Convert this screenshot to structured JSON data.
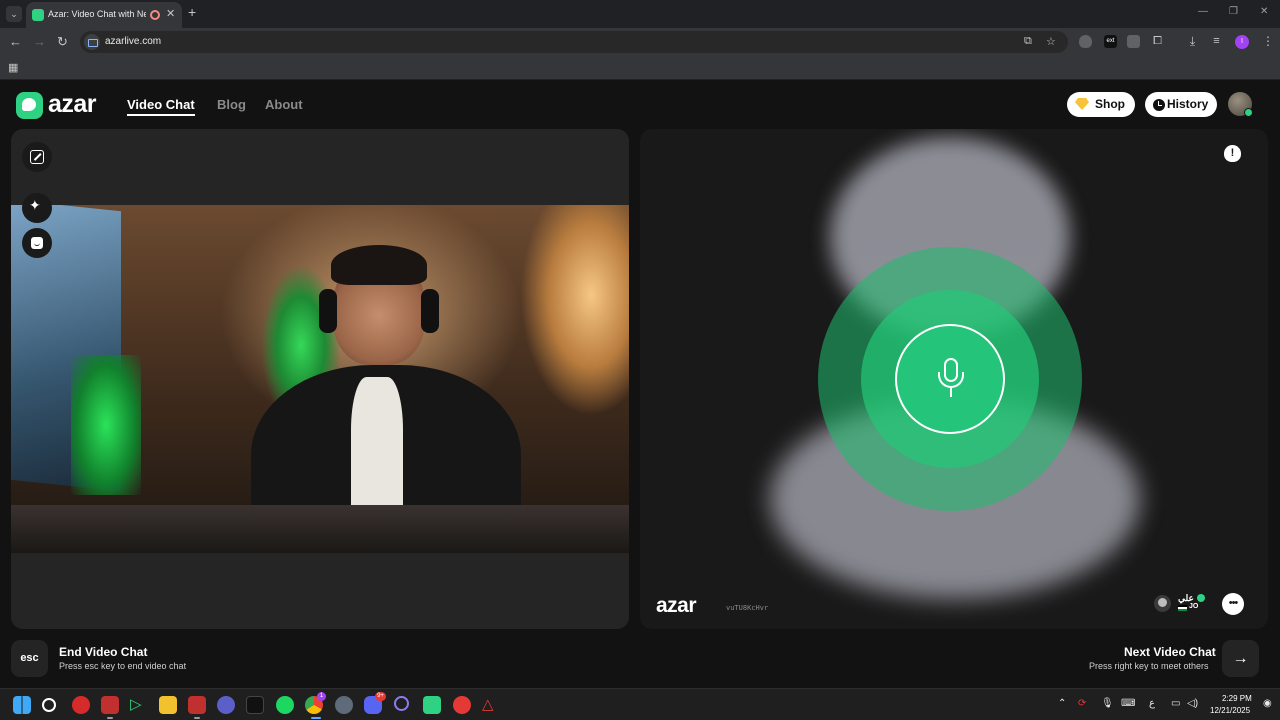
{
  "browser": {
    "tab_title": "Azar: Video Chat with New",
    "tab_close": "✕",
    "new_tab": "+",
    "url": "azarlive.com",
    "profile_initial": "I",
    "ext_label": "ext"
  },
  "header": {
    "logo_text": "azar",
    "nav": [
      "Video Chat",
      "Blog",
      "About"
    ],
    "shop_label": "Shop",
    "history_label": "History"
  },
  "remote": {
    "watermark": "azar",
    "peer_id": "vuTU8KcHvr",
    "peer_name": "علي",
    "peer_country": "JO"
  },
  "actions": {
    "end_key": "esc",
    "end_title": "End Video Chat",
    "end_sub": "Press esc key to end video chat",
    "next_title": "Next Video Chat",
    "next_sub": "Press right key to meet others",
    "next_key": "→"
  },
  "taskbar": {
    "time": "2:29 PM",
    "date": "12/21/2025",
    "lang": "ع",
    "chrome_badge": "1",
    "discord_badge": "9+"
  },
  "colors": {
    "accent": "#2ed282",
    "background": "#121212",
    "panel": "#252525"
  }
}
